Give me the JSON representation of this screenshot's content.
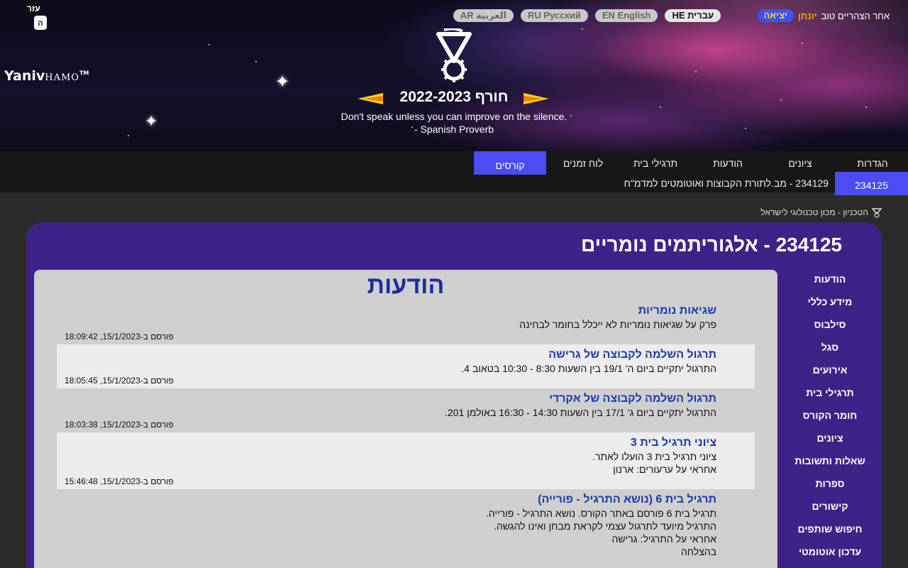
{
  "header": {
    "help_label_top": "עזר",
    "help_label_bottom": "ה",
    "brand_main": "Yaniv",
    "brand_small": "HAMO",
    "brand_tm": "TM",
    "languages": [
      {
        "label": "AR العربية",
        "active": false
      },
      {
        "label": "RU Русский",
        "active": false
      },
      {
        "label": "EN English",
        "active": false
      },
      {
        "label": "HE עברית",
        "active": true
      }
    ],
    "greeting": "אחר הצהריים טוב",
    "username": "יונתן",
    "logout_label": "יציאה",
    "semester": "חורף 2022-2023",
    "quote_line1": "Don't speak unless you can improve on the silence.",
    "quote_line2": "- Spanish Proverb"
  },
  "nav": {
    "items": [
      {
        "label": "הגדרות"
      },
      {
        "label": "ציונים"
      },
      {
        "label": "הודעות"
      },
      {
        "label": "תרגילי בית"
      },
      {
        "label": "לוח זמנים"
      },
      {
        "label": "קורסים"
      }
    ],
    "course_tag": "234125",
    "course_title": "234129 - מב.לתורת הקבוצות ואוטומטים למדמ\"ח"
  },
  "breadcrumb": "הטכניון - מכון טכנולוגי לישראל",
  "course": {
    "title": "234125 - אלגוריתמים נומריים"
  },
  "side_menu": [
    "הודעות",
    "מידע כללי",
    "סילבוס",
    "סגל",
    "אירועים",
    "תרגילי בית",
    "חומר הקורס",
    "ציונים",
    "שאלות ותשובות",
    "ספרות",
    "קישורים",
    "חיפוש שותפים",
    "עדכון אוטומטי"
  ],
  "announcements": {
    "title": "הודעות",
    "items": [
      {
        "title": "שגיאות נומריות",
        "body": [
          "פרק על שגיאות נומריות לא ייכלל בחומר לבחינה"
        ],
        "date": "פורסם ב-15/1/2023, 18:09:42"
      },
      {
        "title": "תרגול השלמה לקבוצה של גרישה",
        "body": [
          "התרגול יתקיים ביום ה' 19/1 בין השעות 8:30 - 10:30 בטאוב 4."
        ],
        "date": "פורסם ב-15/1/2023, 18:05:45"
      },
      {
        "title": "תרגול השלמה לקבוצה של אקרדי",
        "body": [
          "התרגול יתקיים ביום ג' 17/1 בין השעות 14:30 - 16:30 באולמן 201."
        ],
        "date": "פורסם ב-15/1/2023, 18:03:38"
      },
      {
        "title": "ציוני תרגיל בית 3",
        "body": [
          "ציוני תרגיל בית 3 הועלו לאתר.",
          "אחראי על ערעורים: ארנון"
        ],
        "date": "פורסם ב-15/1/2023, 15:46:48"
      },
      {
        "title": "תרגיל בית 6 (נושא התרגיל - פורייה)",
        "body": [
          "תרגיל בית 6 פורסם באתר הקורס. נושא התרגיל - פורייה.",
          "התרגיל מיועד לתרגול עצמי לקראת מבחן ואינו להגשה.",
          "אחראי על התרגיל: גרישה",
          "בהצלחה"
        ],
        "date": ""
      }
    ]
  },
  "colors": {
    "accent": "#4b4cf2",
    "panel": "#3f2287",
    "title_blue": "#1a2d9a",
    "username": "#f0a400"
  }
}
